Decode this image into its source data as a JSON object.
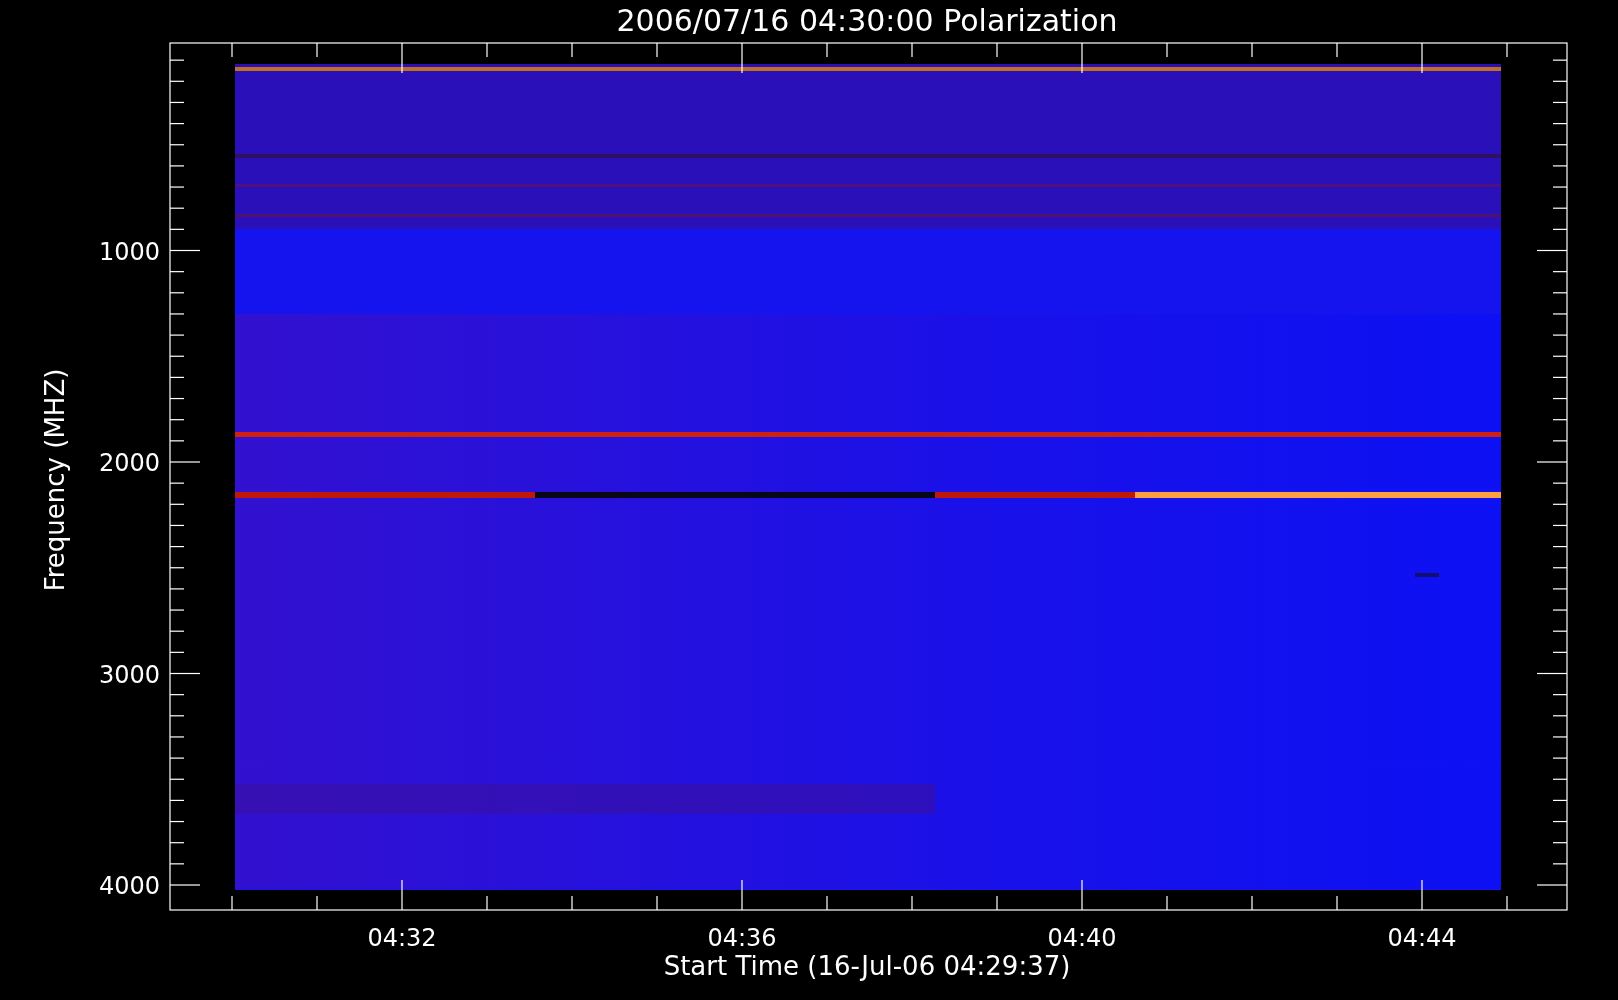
{
  "title": "2006/07/16 04:30:00 Polarization",
  "x_axis": {
    "label": "Start Time (16-Jul-06 04:29:37)",
    "ticks": [
      "04:32",
      "04:36",
      "04:40",
      "04:44"
    ]
  },
  "y_axis": {
    "label": "Frequency (MHZ)",
    "ticks": [
      "1000",
      "2000",
      "3000",
      "4000"
    ]
  }
}
